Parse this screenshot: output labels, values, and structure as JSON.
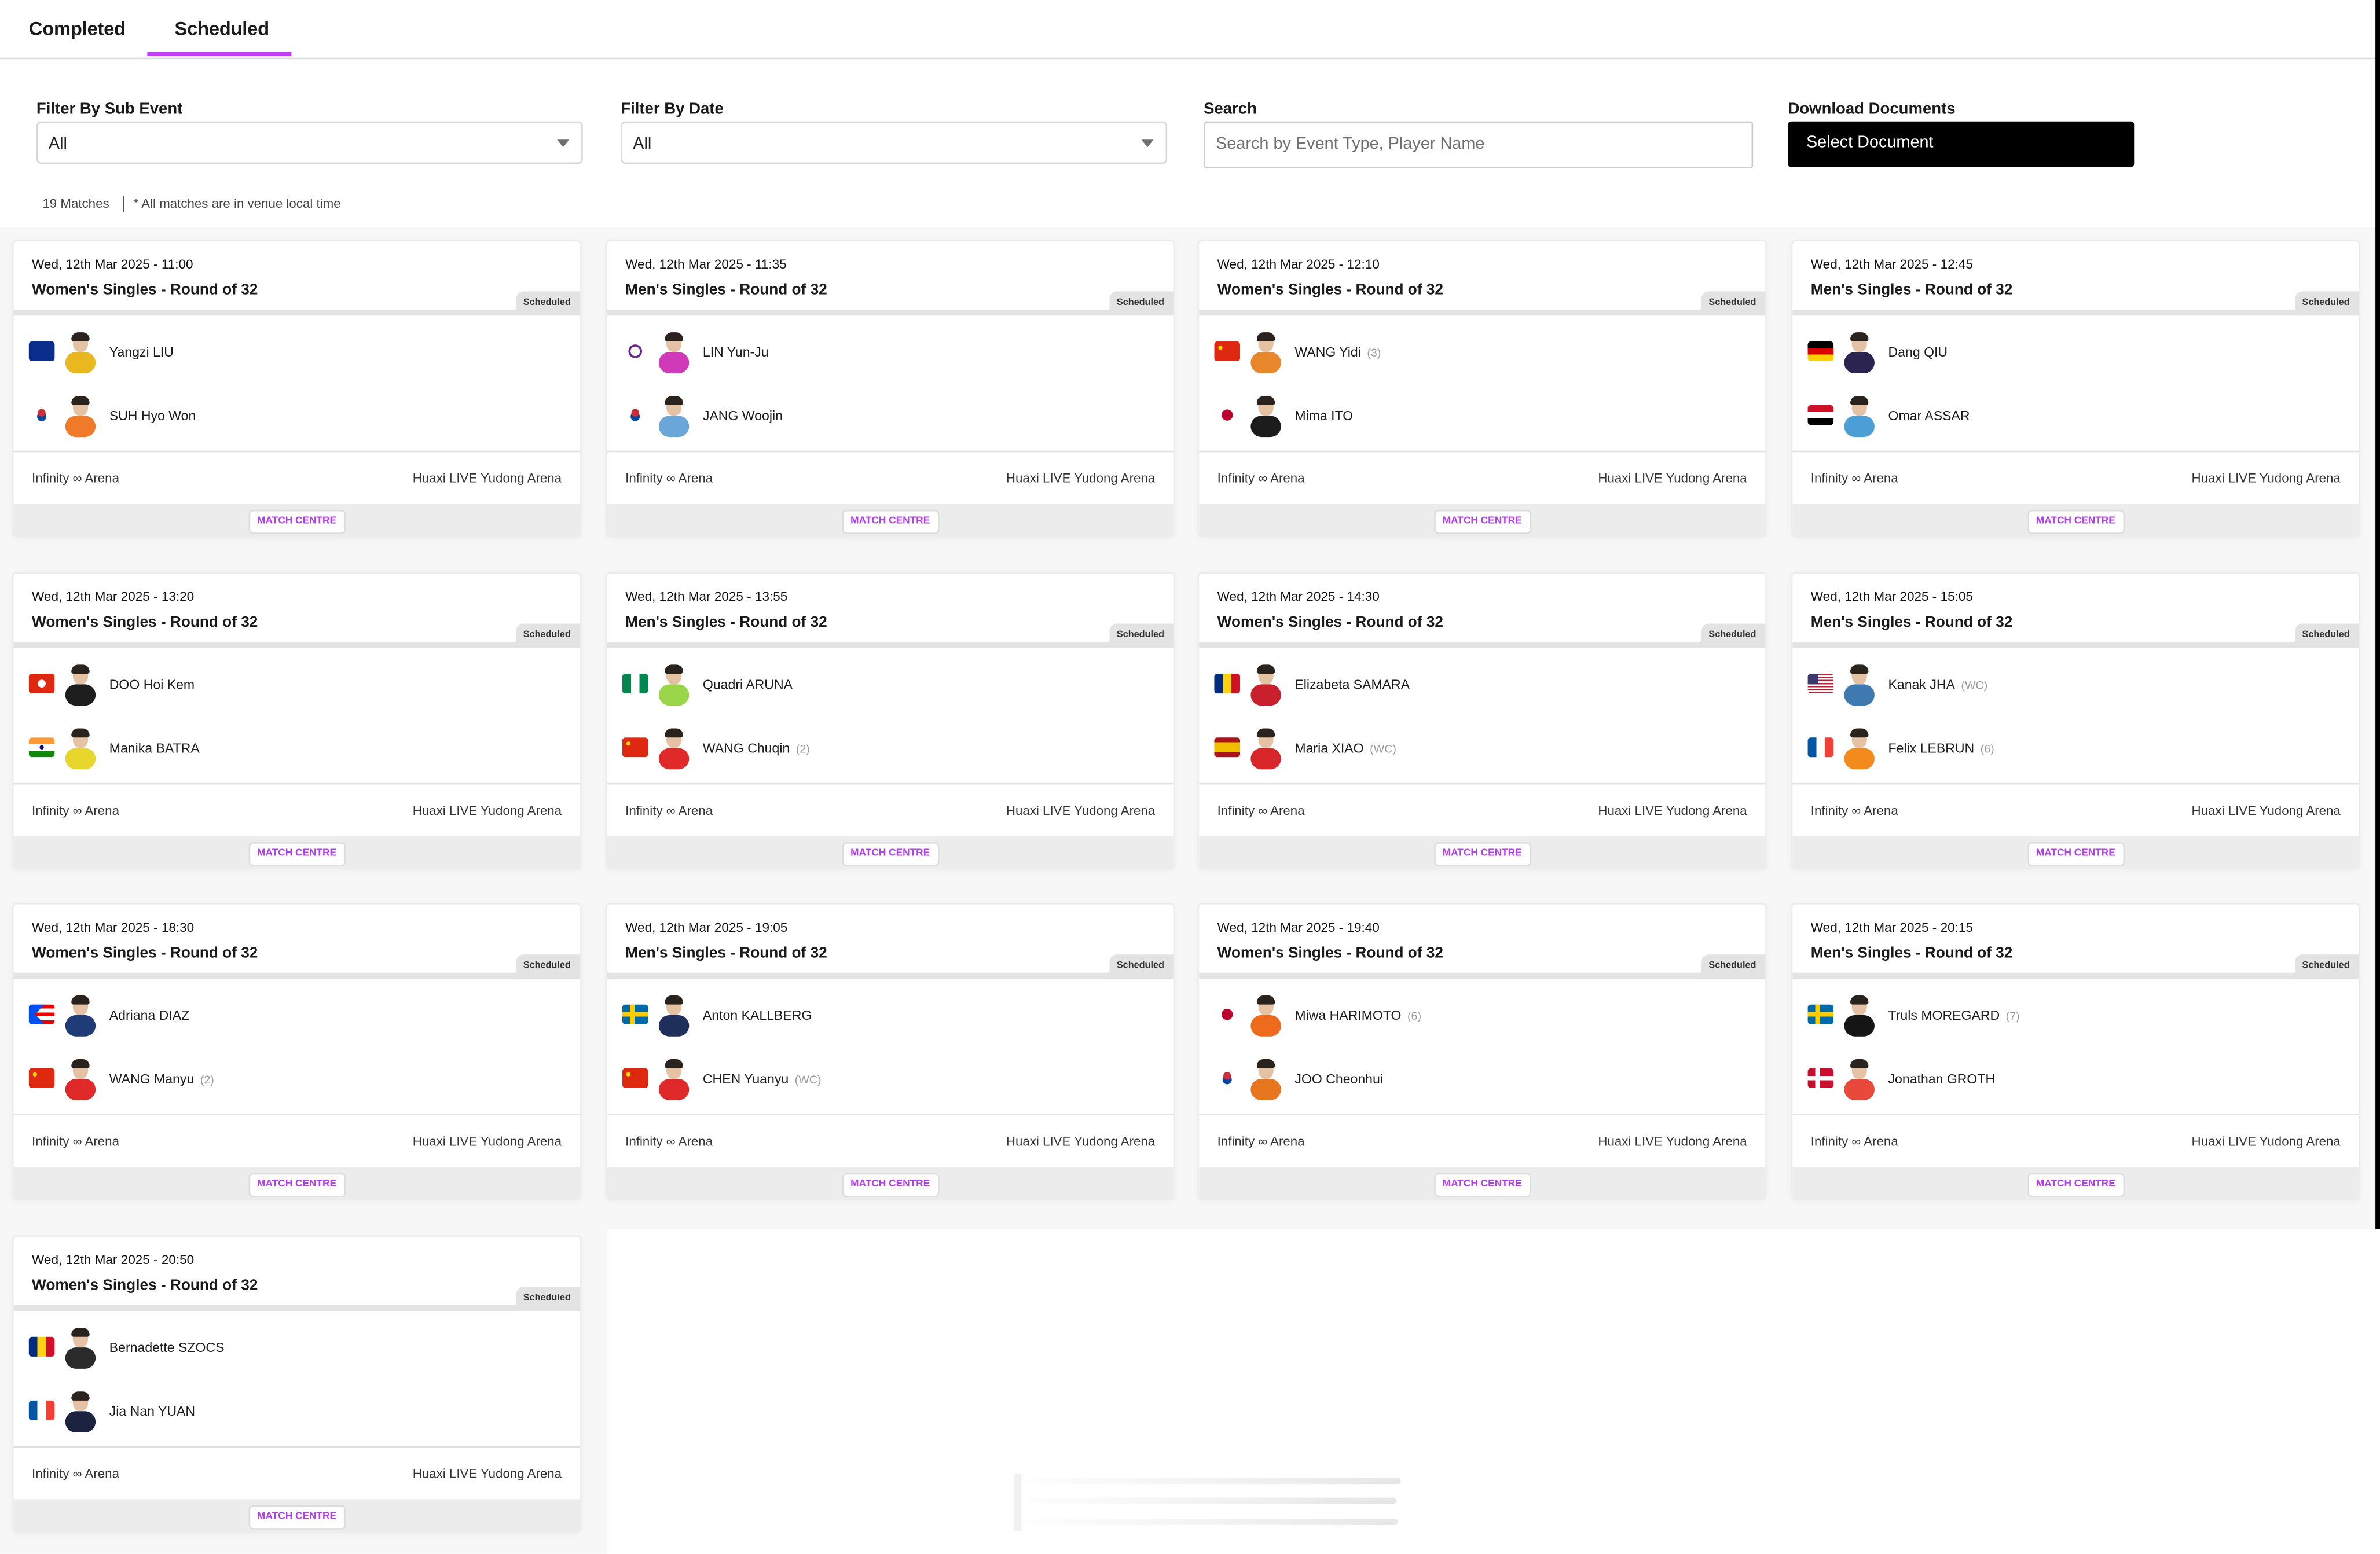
{
  "tabs": [
    {
      "label": "Completed",
      "active": false
    },
    {
      "label": "Scheduled",
      "active": true
    }
  ],
  "accent_color": "#c03cf5",
  "filters": {
    "sub_event": {
      "label": "Filter By Sub Event",
      "value": "All"
    },
    "date": {
      "label": "Filter By Date",
      "value": "All"
    },
    "search": {
      "label": "Search",
      "placeholder": "Search by Event Type, Player Name",
      "value": ""
    },
    "download": {
      "label": "Download Documents",
      "button": "Select Document"
    }
  },
  "meta": {
    "count": "19 Matches",
    "note": "* All matches are in venue local time"
  },
  "match_centre_label": "MATCH CENTRE",
  "matches": [
    {
      "datetime": "Wed, 12th Mar 2025 - 11:00",
      "event": "Women's Singles - Round of 32",
      "status": "Scheduled",
      "venue_left": "Infinity ∞ Arena",
      "venue_right": "Huaxi LIVE Yudong Arena",
      "players": [
        {
          "name": "Yangzi LIU",
          "seed": "",
          "flag": "australia-flag",
          "kit": "#e9b820"
        },
        {
          "name": "SUH Hyo Won",
          "seed": "",
          "flag": "korea-flag",
          "kit": "#f07a2a"
        }
      ]
    },
    {
      "datetime": "Wed, 12th Mar 2025 - 11:35",
      "event": "Men's Singles - Round of 32",
      "status": "Scheduled",
      "venue_left": "Infinity ∞ Arena",
      "venue_right": "Huaxi LIVE Yudong Arena",
      "players": [
        {
          "name": "LIN Yun-Ju",
          "seed": "",
          "flag": "chinese-taipei-flag",
          "kit": "#d03ab8"
        },
        {
          "name": "JANG Woojin",
          "seed": "",
          "flag": "korea-flag",
          "kit": "#6aa7d8"
        }
      ]
    },
    {
      "datetime": "Wed, 12th Mar 2025 - 12:10",
      "event": "Women's Singles - Round of 32",
      "status": "Scheduled",
      "venue_left": "Infinity ∞ Arena",
      "venue_right": "Huaxi LIVE Yudong Arena",
      "players": [
        {
          "name": "WANG Yidi",
          "seed": "(3)",
          "flag": "china-flag",
          "kit": "#e8872b"
        },
        {
          "name": "Mima ITO",
          "seed": "",
          "flag": "japan-flag",
          "kit": "#1c1c1c"
        }
      ]
    },
    {
      "datetime": "Wed, 12th Mar 2025 - 12:45",
      "event": "Men's Singles - Round of 32",
      "status": "Scheduled",
      "venue_left": "Infinity ∞ Arena",
      "venue_right": "Huaxi LIVE Yudong Arena",
      "players": [
        {
          "name": "Dang QIU",
          "seed": "",
          "flag": "germany-flag",
          "kit": "#2b2350"
        },
        {
          "name": "Omar ASSAR",
          "seed": "",
          "flag": "egypt-flag",
          "kit": "#4b9fd6"
        }
      ]
    },
    {
      "datetime": "Wed, 12th Mar 2025 - 13:20",
      "event": "Women's Singles - Round of 32",
      "status": "Scheduled",
      "venue_left": "Infinity ∞ Arena",
      "venue_right": "Huaxi LIVE Yudong Arena",
      "players": [
        {
          "name": "DOO Hoi Kem",
          "seed": "",
          "flag": "hong-kong-flag",
          "kit": "#1e1e1e"
        },
        {
          "name": "Manika BATRA",
          "seed": "",
          "flag": "india-flag",
          "kit": "#e7d62c"
        }
      ]
    },
    {
      "datetime": "Wed, 12th Mar 2025 - 13:55",
      "event": "Men's Singles - Round of 32",
      "status": "Scheduled",
      "venue_left": "Infinity ∞ Arena",
      "venue_right": "Huaxi LIVE Yudong Arena",
      "players": [
        {
          "name": "Quadri ARUNA",
          "seed": "",
          "flag": "nigeria-flag",
          "kit": "#9ad64a"
        },
        {
          "name": "WANG Chuqin",
          "seed": "(2)",
          "flag": "china-flag",
          "kit": "#e02a2a"
        }
      ]
    },
    {
      "datetime": "Wed, 12th Mar 2025 - 14:30",
      "event": "Women's Singles - Round of 32",
      "status": "Scheduled",
      "venue_left": "Infinity ∞ Arena",
      "venue_right": "Huaxi LIVE Yudong Arena",
      "players": [
        {
          "name": "Elizabeta SAMARA",
          "seed": "",
          "flag": "romania-flag",
          "kit": "#c8202c"
        },
        {
          "name": "Maria XIAO",
          "seed": "(WC)",
          "flag": "spain-flag",
          "kit": "#d8262a"
        }
      ]
    },
    {
      "datetime": "Wed, 12th Mar 2025 - 15:05",
      "event": "Men's Singles - Round of 32",
      "status": "Scheduled",
      "venue_left": "Infinity ∞ Arena",
      "venue_right": "Huaxi LIVE Yudong Arena",
      "players": [
        {
          "name": "Kanak JHA",
          "seed": "(WC)",
          "flag": "usa-flag",
          "kit": "#3e79b0"
        },
        {
          "name": "Felix LEBRUN",
          "seed": "(6)",
          "flag": "france-flag",
          "kit": "#f28a1e"
        }
      ]
    },
    {
      "datetime": "Wed, 12th Mar 2025 - 18:30",
      "event": "Women's Singles - Round of 32",
      "status": "Scheduled",
      "venue_left": "Infinity ∞ Arena",
      "venue_right": "Huaxi LIVE Yudong Arena",
      "players": [
        {
          "name": "Adriana DIAZ",
          "seed": "",
          "flag": "puerto-rico-flag",
          "kit": "#1f3c78"
        },
        {
          "name": "WANG Manyu",
          "seed": "(2)",
          "flag": "china-flag",
          "kit": "#e02a2a"
        }
      ]
    },
    {
      "datetime": "Wed, 12th Mar 2025 - 19:05",
      "event": "Men's Singles - Round of 32",
      "status": "Scheduled",
      "venue_left": "Infinity ∞ Arena",
      "venue_right": "Huaxi LIVE Yudong Arena",
      "players": [
        {
          "name": "Anton KALLBERG",
          "seed": "",
          "flag": "sweden-flag",
          "kit": "#1d2f5a"
        },
        {
          "name": "CHEN Yuanyu",
          "seed": "(WC)",
          "flag": "china-flag",
          "kit": "#e02a2a"
        }
      ]
    },
    {
      "datetime": "Wed, 12th Mar 2025 - 19:40",
      "event": "Women's Singles - Round of 32",
      "status": "Scheduled",
      "venue_left": "Infinity ∞ Arena",
      "venue_right": "Huaxi LIVE Yudong Arena",
      "players": [
        {
          "name": "Miwa HARIMOTO",
          "seed": "(6)",
          "flag": "japan-flag",
          "kit": "#ee6a1c"
        },
        {
          "name": "JOO Cheonhui",
          "seed": "",
          "flag": "korea-flag",
          "kit": "#e8761e"
        }
      ]
    },
    {
      "datetime": "Wed, 12th Mar 2025 - 20:15",
      "event": "Men's Singles - Round of 32",
      "status": "Scheduled",
      "venue_left": "Infinity ∞ Arena",
      "venue_right": "Huaxi LIVE Yudong Arena",
      "players": [
        {
          "name": "Truls MOREGARD",
          "seed": "(7)",
          "flag": "sweden-flag",
          "kit": "#151515"
        },
        {
          "name": "Jonathan GROTH",
          "seed": "",
          "flag": "denmark-flag",
          "kit": "#e8493a"
        }
      ]
    },
    {
      "datetime": "Wed, 12th Mar 2025 - 20:50",
      "event": "Women's Singles - Round of 32",
      "status": "Scheduled",
      "venue_left": "Infinity ∞ Arena",
      "venue_right": "Huaxi LIVE Yudong Arena",
      "players": [
        {
          "name": "Bernadette SZOCS",
          "seed": "",
          "flag": "romania-flag",
          "kit": "#2a2a2a"
        },
        {
          "name": "Jia Nan YUAN",
          "seed": "",
          "flag": "france-flag",
          "kit": "#1c2340"
        }
      ]
    }
  ]
}
